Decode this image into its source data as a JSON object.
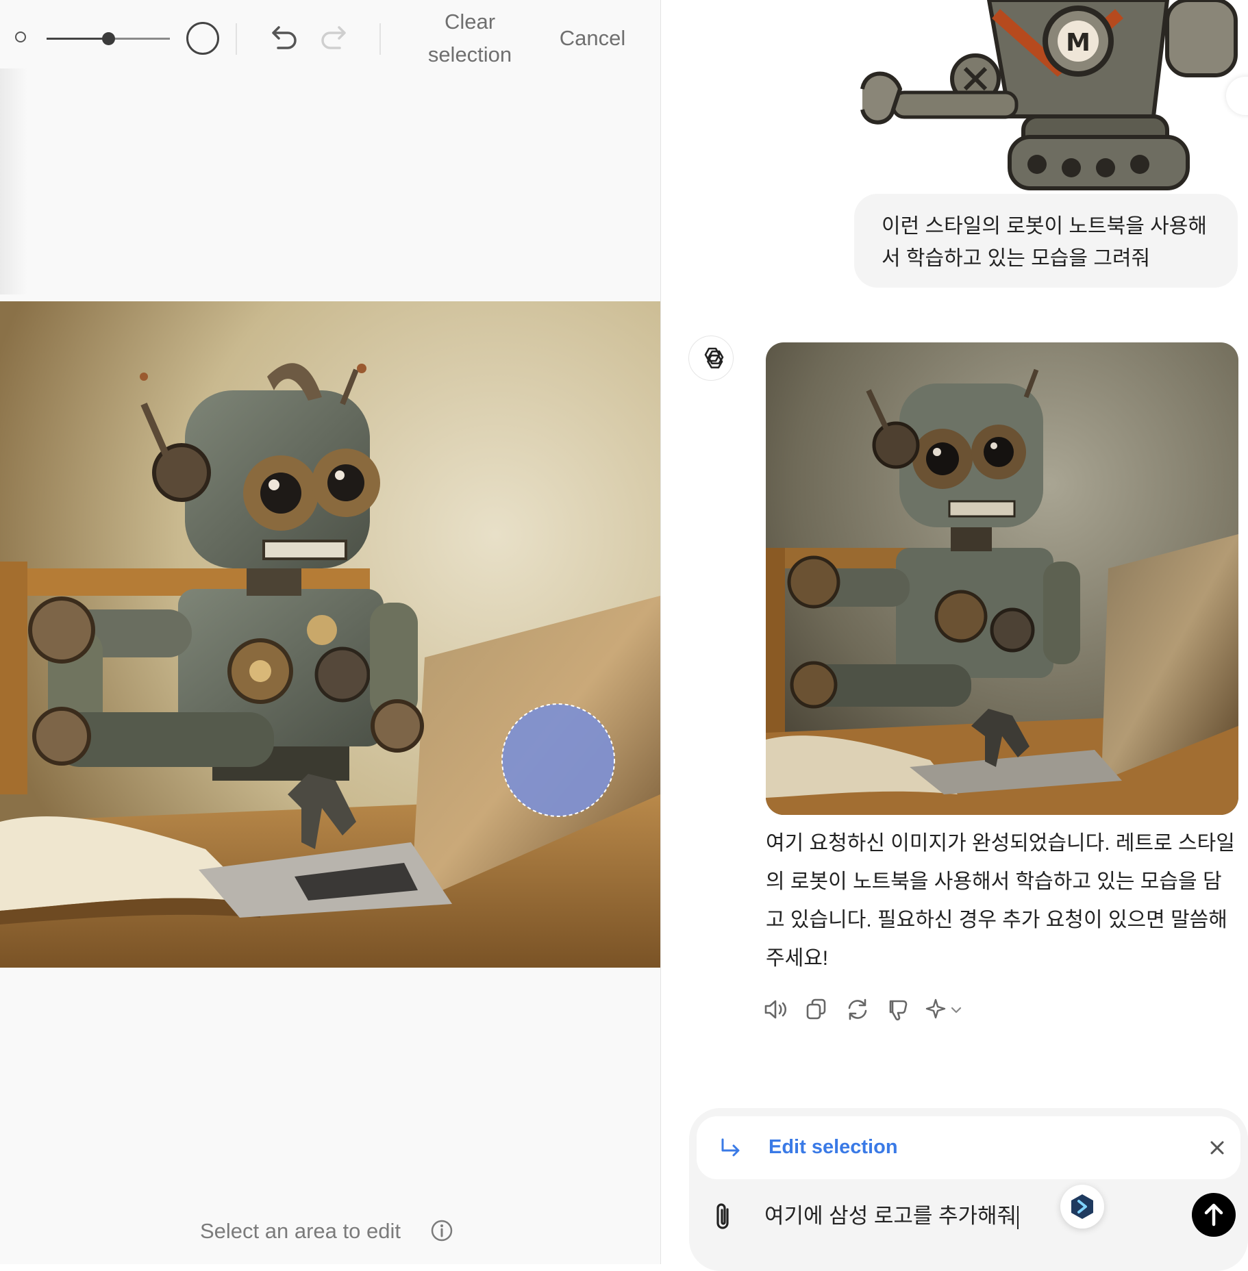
{
  "editor": {
    "toolbar": {
      "brush_size_level": 0.5,
      "clear_selection_label_line1": "Clear",
      "clear_selection_label_line2": "selection",
      "cancel_label": "Cancel"
    },
    "hint": "Select an area to edit",
    "selection_color": "#8090d0"
  },
  "chat": {
    "user_message_line1": "이런 스타일의 로봇이 노트북을 사용해",
    "user_message_line2": "서 학습하고 있는 모습을 그려줘",
    "assistant_message_lines": [
      "여기 요청하신 이미지가 완성되었습니다. 레트로 스타일",
      "의 로봇이 노트북을 사용해서 학습하고 있는 모습을 담",
      "고 있습니다. 필요하신 경우 추가 요청이 있으면 말씀해",
      "주세요!"
    ],
    "actions": [
      "speaker-icon",
      "copy-icon",
      "regenerate-icon",
      "thumbs-down-icon",
      "sparkle-model-icon"
    ]
  },
  "composer": {
    "edit_chip_label": "Edit selection",
    "input_value": "여기에 삼성 로고를 추가해줘",
    "accent": "#3a7ae6"
  }
}
